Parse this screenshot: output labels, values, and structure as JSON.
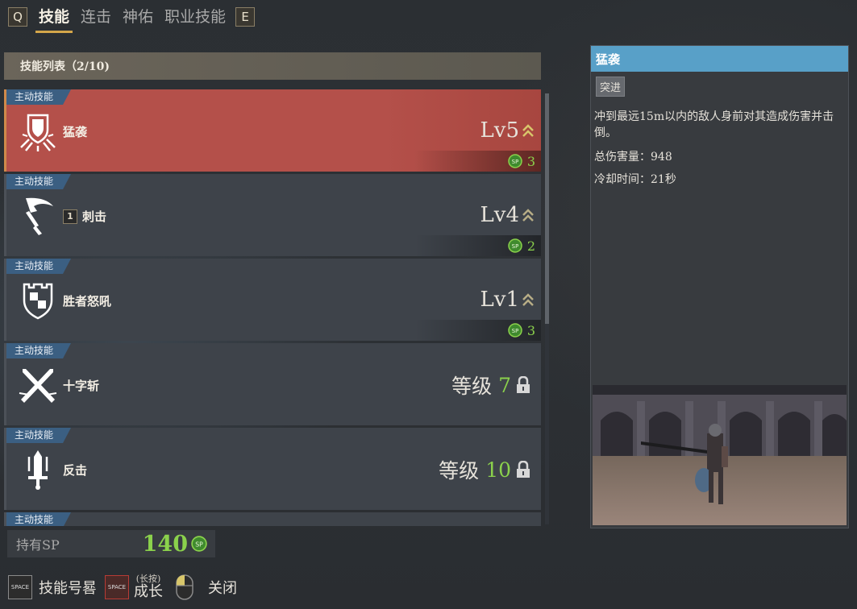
{
  "nav": {
    "left_key": "Q",
    "right_key": "E",
    "tabs": [
      {
        "label": "技能",
        "active": true
      },
      {
        "label": "连击",
        "active": false
      },
      {
        "label": "神佑",
        "active": false
      },
      {
        "label": "职业技能",
        "active": false
      }
    ]
  },
  "list": {
    "header": "技能列表（2/10)",
    "rows": [
      {
        "tag": "主动技能",
        "name": "猛袭",
        "slot": "",
        "level": "Lv5",
        "sp_cost": "3",
        "selected": true,
        "icon": "shield-burst-icon"
      },
      {
        "tag": "主动技能",
        "name": "刺击",
        "slot": "1",
        "level": "Lv4",
        "sp_cost": "2",
        "selected": false,
        "icon": "curved-blade-icon"
      },
      {
        "tag": "主动技能",
        "name": "胜者怒吼",
        "slot": "",
        "level": "Lv1",
        "sp_cost": "3",
        "selected": false,
        "icon": "castle-shield-icon"
      },
      {
        "tag": "主动技能",
        "name": "十字斩",
        "slot": "",
        "req_label": "等级",
        "req_level": "7",
        "locked": true,
        "icon": "cross-slash-icon"
      },
      {
        "tag": "主动技能",
        "name": "反击",
        "slot": "",
        "req_label": "等级",
        "req_level": "10",
        "locked": true,
        "icon": "counter-sword-icon"
      },
      {
        "tag": "主动技能"
      }
    ]
  },
  "sp": {
    "label": "持有SP",
    "value": "140",
    "icon_text": "SP"
  },
  "hints": {
    "register_key": "SPACE",
    "register_label": "技能号晷",
    "grow_key": "SPACE",
    "grow_sub": "(长按)",
    "grow_label": "成长",
    "close_label": "关闭"
  },
  "detail": {
    "title": "猛袭",
    "chip": "突进",
    "description": "冲到最远15m以内的敌人身前对其造成伤害并击倒。",
    "damage": "总伤害量：948",
    "cooldown": "冷却时间：21秒"
  },
  "colors": {
    "selected_row": "#b4504a",
    "row_bg": "#3e434a",
    "tag_bg": "#3b5f82",
    "sp_green": "#8bd14c",
    "detail_title": "#58a0c8",
    "tab_underline": "#d4a64a"
  }
}
